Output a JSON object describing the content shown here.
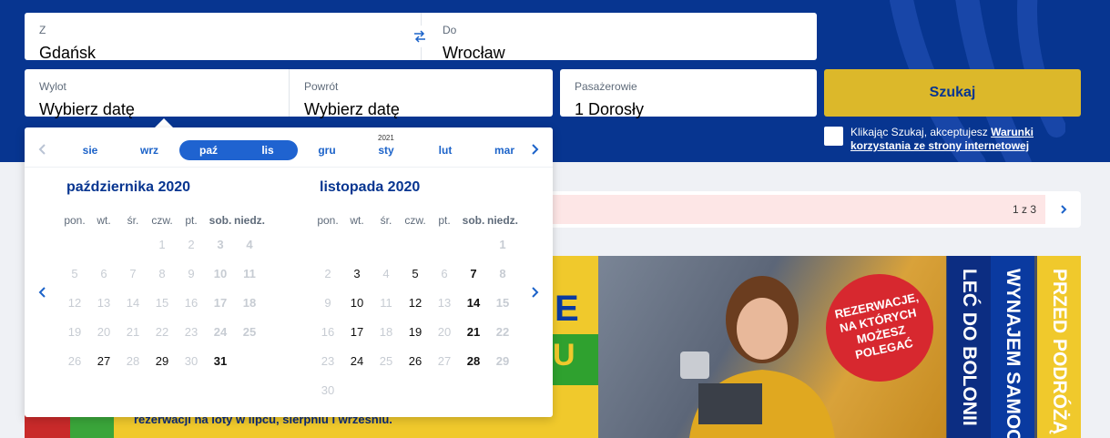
{
  "search": {
    "from": {
      "label": "Z",
      "value": "Gdańsk"
    },
    "to": {
      "label": "Do",
      "value": "Wrocław"
    },
    "departure": {
      "label": "Wylot",
      "value": "Wybierz datę"
    },
    "return": {
      "label": "Powrót",
      "value": "Wybierz datę"
    },
    "passengers": {
      "label": "Pasażerowie",
      "value": "1 Dorosły"
    },
    "search_button": "Szukaj",
    "terms_prefix": "Klikając Szukaj, akceptujesz",
    "terms_link": "Warunki korzystania ze strony internetowej"
  },
  "alert": {
    "counter": "1 z 3"
  },
  "datepicker": {
    "strip": [
      "sie",
      "wrz",
      "paź",
      "lis",
      "gru",
      "sty",
      "lut",
      "mar"
    ],
    "strip_year": "2021",
    "weekdays": [
      "pon.",
      "wt.",
      "śr.",
      "czw.",
      "pt.",
      "sob.",
      "niedz."
    ],
    "months": [
      {
        "title": "października 2020",
        "weeks": [
          [
            "",
            "",
            "",
            "1",
            "2",
            "3",
            "4"
          ],
          [
            "5",
            "6",
            "7",
            "8",
            "9",
            "10",
            "11"
          ],
          [
            "12",
            "13",
            "14",
            "15",
            "16",
            "17",
            "18"
          ],
          [
            "19",
            "20",
            "21",
            "22",
            "23",
            "24",
            "25"
          ],
          [
            "26",
            "27",
            "28",
            "29",
            "30",
            "31",
            ""
          ]
        ],
        "available": [
          "27",
          "29",
          "31"
        ]
      },
      {
        "title": "listopada 2020",
        "weeks": [
          [
            "",
            "",
            "",
            "",
            "",
            "",
            "1"
          ],
          [
            "2",
            "3",
            "4",
            "5",
            "6",
            "7",
            "8"
          ],
          [
            "9",
            "10",
            "11",
            "12",
            "13",
            "14",
            "15"
          ],
          [
            "16",
            "17",
            "18",
            "19",
            "20",
            "21",
            "22"
          ],
          [
            "23",
            "24",
            "25",
            "26",
            "27",
            "28",
            "29"
          ],
          [
            "30",
            "",
            "",
            "",
            "",
            "",
            ""
          ]
        ],
        "available": [
          "3",
          "5",
          "7",
          "10",
          "12",
          "14",
          "17",
          "19",
          "21",
          "24",
          "26",
          "28"
        ]
      }
    ]
  },
  "banner": {
    "big_letter": "E",
    "small_letter": "U",
    "subtext": "rezerwacji na loty w lipcu, sierpniu i wrześniu.",
    "badge": "REZERWACJE, NA KTÓRYCH MOŻESZ POLEGAĆ",
    "tabs": [
      "LEĆ DO BOLONII",
      "WYNAJEM SAMOC",
      "PRZED PODRÓŻĄ"
    ]
  },
  "colors": {
    "brand_blue": "#073590",
    "accent_yellow": "#dcb82a",
    "link_blue": "#1c63c9"
  }
}
